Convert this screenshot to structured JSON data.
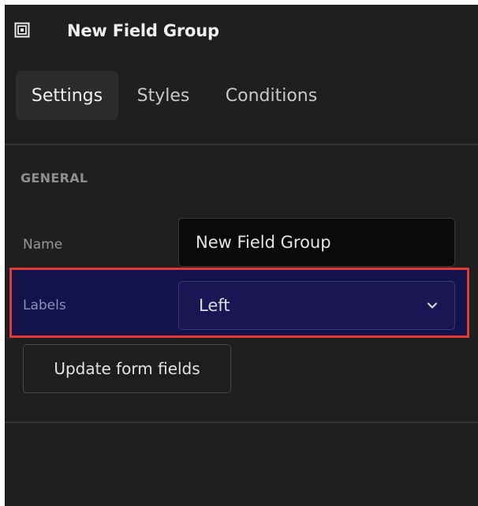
{
  "header": {
    "icon": "field-group-icon",
    "title": "New Field Group"
  },
  "tabs": [
    {
      "label": "Settings",
      "active": true
    },
    {
      "label": "Styles",
      "active": false
    },
    {
      "label": "Conditions",
      "active": false
    }
  ],
  "general": {
    "section_title": "GENERAL",
    "name": {
      "label": "Name",
      "value": "New Field Group"
    },
    "labels": {
      "label": "Labels",
      "selected": "Left",
      "icon": "chevron-down-icon"
    },
    "update_button": "Update form fields"
  },
  "colors": {
    "panel_bg": "#1f1f1f",
    "highlight_border": "#e53935",
    "highlight_bg": "#14124a",
    "select_bg": "#1a1653"
  }
}
